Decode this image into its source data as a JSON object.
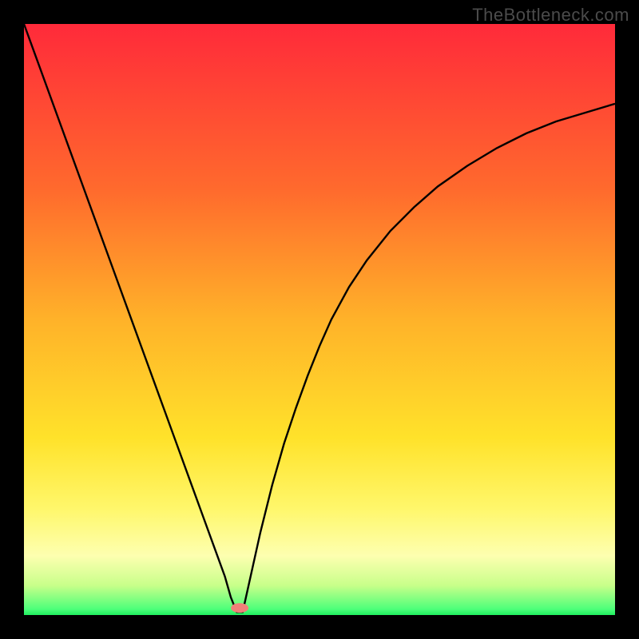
{
  "watermark": "TheBottleneck.com",
  "chart_data": {
    "type": "line",
    "title": "",
    "xlabel": "",
    "ylabel": "",
    "xlim": [
      0,
      100
    ],
    "ylim": [
      0,
      100
    ],
    "x": [
      0,
      2,
      4,
      6,
      8,
      10,
      12,
      14,
      16,
      18,
      20,
      22,
      24,
      26,
      28,
      30,
      32,
      34,
      35,
      36,
      37,
      38,
      40,
      42,
      44,
      46,
      48,
      50,
      52,
      55,
      58,
      62,
      66,
      70,
      75,
      80,
      85,
      90,
      95,
      100
    ],
    "values": [
      100,
      94.5,
      89,
      83.5,
      78,
      72.5,
      67,
      61.5,
      56,
      50.5,
      45,
      39.5,
      34,
      28.5,
      23,
      17.5,
      12,
      6.5,
      3,
      0.5,
      0.5,
      5,
      14,
      22,
      29,
      35,
      40.5,
      45.5,
      50,
      55.5,
      60,
      65,
      69,
      72.5,
      76,
      79,
      81.5,
      83.5,
      85,
      86.5
    ],
    "gradient_stops": [
      {
        "offset": 0.0,
        "color": "#ff2a3a"
      },
      {
        "offset": 0.28,
        "color": "#ff6a2d"
      },
      {
        "offset": 0.5,
        "color": "#ffb229"
      },
      {
        "offset": 0.7,
        "color": "#ffe22a"
      },
      {
        "offset": 0.82,
        "color": "#fff76b"
      },
      {
        "offset": 0.9,
        "color": "#fdffb0"
      },
      {
        "offset": 0.95,
        "color": "#c8ff8a"
      },
      {
        "offset": 0.99,
        "color": "#4dff7a"
      },
      {
        "offset": 1.0,
        "color": "#1fee5e"
      }
    ],
    "marker": {
      "x": 36.5,
      "y": 1.2,
      "color": "#f08078",
      "rx": 11,
      "ry": 6
    }
  }
}
